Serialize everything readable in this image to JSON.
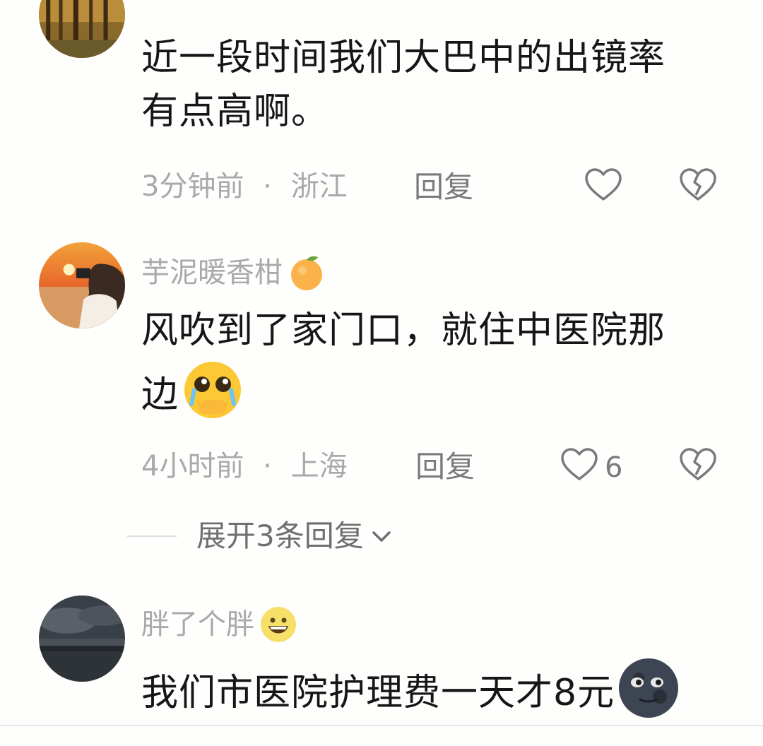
{
  "comments": [
    {
      "name": "",
      "text_lines": [
        "近一段时间我们大巴中的出镜率",
        "有点高啊。"
      ],
      "time": "3分钟前",
      "sep": "·",
      "location": "浙江",
      "reply_label": "回复",
      "like_count": "",
      "avatar_icon": "autumn-forest-avatar"
    },
    {
      "name": "芋泥暖香柑",
      "name_emoji": "tangerine-icon",
      "text_lines": [
        "风吹到了家门口，就住中医院那",
        "边"
      ],
      "text_emoji": "pleading-cry-emoji",
      "time": "4小时前",
      "sep": "·",
      "location": "上海",
      "reply_label": "回复",
      "like_count": "6",
      "avatar_icon": "sunset-girl-avatar"
    },
    {
      "name": "胖了个胖",
      "name_emoji": "grinning-face-icon",
      "text_lines": [
        "我们市医院护理费一天才8元"
      ],
      "text_emoji": "new-moon-face-emoji",
      "avatar_icon": "cloudy-sea-avatar"
    }
  ],
  "expand_replies": {
    "label": "展开3条回复"
  },
  "colors": {
    "meta": "#a9a9a9",
    "text": "#161616",
    "reply": "#7a7a7a",
    "background": "#fefefc"
  }
}
